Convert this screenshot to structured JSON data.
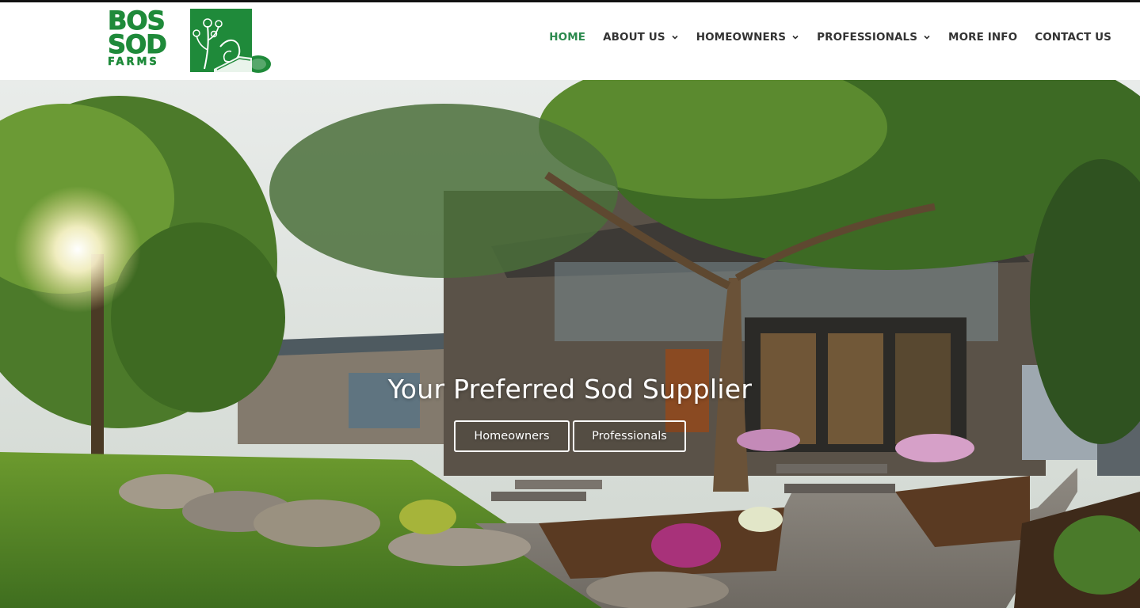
{
  "brand": {
    "logo_line1": "BOS",
    "logo_line2": "SOD",
    "logo_line3": "FARMS",
    "logo_icon": "sod-roll-plant-icon",
    "brand_green": "#1f8a3a"
  },
  "nav": {
    "active_color": "#2c8a4e",
    "items": [
      {
        "label": "HOME",
        "active": true,
        "has_dropdown": false
      },
      {
        "label": "ABOUT US",
        "active": false,
        "has_dropdown": true
      },
      {
        "label": "HOMEOWNERS",
        "active": false,
        "has_dropdown": true
      },
      {
        "label": "PROFESSIONALS",
        "active": false,
        "has_dropdown": true
      },
      {
        "label": "MORE INFO",
        "active": false,
        "has_dropdown": false
      },
      {
        "label": "CONTACT US",
        "active": false,
        "has_dropdown": false
      }
    ]
  },
  "hero": {
    "title": "Your Preferred Sod Supplier",
    "buttons": [
      {
        "label": "Homeowners"
      },
      {
        "label": "Professionals"
      }
    ]
  }
}
